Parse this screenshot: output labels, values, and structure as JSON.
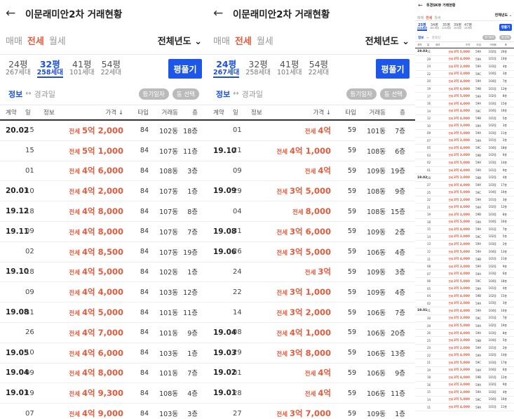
{
  "panels": [
    {
      "title": "이문래미안2차 거래현황",
      "types": [
        "매매",
        "전세",
        "월세"
      ],
      "active_type": 1,
      "year": "전체년도",
      "sizes": [
        {
          "py": "24평",
          "units": "267세대"
        },
        {
          "py": "32평",
          "units": "258세대"
        },
        {
          "py": "41평",
          "units": "101세대"
        },
        {
          "py": "54평",
          "units": "22세대"
        }
      ],
      "active_size": 1,
      "pyeong_button": "평풀기",
      "info_label": "정보",
      "elapsed_label": "경과일",
      "pills": [
        "등기일자",
        "동 선택"
      ],
      "headers": {
        "contract": "계약",
        "day": "일",
        "info": "정보",
        "price": "가격 ↓",
        "type": "타입",
        "dong": "거래동",
        "floor": "층"
      },
      "rows": [
        {
          "c": "20.02",
          "d": "15",
          "i": "",
          "l": "전세",
          "p": "5억 2,000",
          "t": "84",
          "b": "102동",
          "f": "18층"
        },
        {
          "c": "",
          "d": "15",
          "i": "",
          "l": "전세",
          "p": "5억 1,000",
          "t": "84",
          "b": "107동",
          "f": "11층"
        },
        {
          "c": "",
          "d": "01",
          "i": "",
          "l": "전세",
          "p": "4억 6,000",
          "t": "84",
          "b": "108동",
          "f": "3층"
        },
        {
          "c": "20.01",
          "d": "10",
          "i": "",
          "l": "전세",
          "p": "4억 2,000",
          "t": "84",
          "b": "107동",
          "f": "1층"
        },
        {
          "c": "19.12",
          "d": "18",
          "i": "",
          "l": "전세",
          "p": "4억 8,000",
          "t": "84",
          "b": "107동",
          "f": "8층"
        },
        {
          "c": "19.11",
          "d": "09",
          "i": "",
          "l": "전세",
          "p": "4억 8,000",
          "t": "84",
          "b": "107동",
          "f": "7층"
        },
        {
          "c": "",
          "d": "02",
          "i": "",
          "l": "전세",
          "p": "4억 8,500",
          "t": "84",
          "b": "107동",
          "f": "19층"
        },
        {
          "c": "19.10",
          "d": "18",
          "i": "",
          "l": "전세",
          "p": "4억 5,000",
          "t": "84",
          "b": "102동",
          "f": "1층"
        },
        {
          "c": "",
          "d": "09",
          "i": "",
          "l": "전세",
          "p": "4억 4,000",
          "t": "84",
          "b": "103동",
          "f": "12층"
        },
        {
          "c": "19.08",
          "d": "31",
          "i": "",
          "l": "전세",
          "p": "4억 5,000",
          "t": "84",
          "b": "101동",
          "f": "11층"
        },
        {
          "c": "",
          "d": "26",
          "i": "",
          "l": "전세",
          "p": "4억 7,000",
          "t": "84",
          "b": "101동",
          "f": "9층"
        },
        {
          "c": "19.05",
          "d": "10",
          "i": "",
          "l": "전세",
          "p": "4억 6,000",
          "t": "84",
          "b": "103동",
          "f": "1층"
        },
        {
          "c": "19.04",
          "d": "09",
          "i": "",
          "l": "전세",
          "p": "4억 8,000",
          "t": "84",
          "b": "101동",
          "f": "7층"
        },
        {
          "c": "19.01",
          "d": "19",
          "i": "",
          "l": "전세",
          "p": "4억 9,300",
          "t": "84",
          "b": "108동",
          "f": "4층"
        },
        {
          "c": "",
          "d": "07",
          "i": "",
          "l": "전세",
          "p": "4억 9,000",
          "t": "84",
          "b": "103동",
          "f": "3층"
        }
      ]
    },
    {
      "title": "이문래미안2차 거래현황",
      "types": [
        "매매",
        "전세",
        "월세"
      ],
      "active_type": 1,
      "year": "전체년도",
      "sizes": [
        {
          "py": "24평",
          "units": "267세대"
        },
        {
          "py": "32평",
          "units": "258세대"
        },
        {
          "py": "41평",
          "units": "101세대"
        },
        {
          "py": "54평",
          "units": "22세대"
        }
      ],
      "active_size": 0,
      "pyeong_button": "평풀기",
      "info_label": "정보",
      "elapsed_label": "경과일",
      "pills": [
        "등기일자",
        "동 선택"
      ],
      "headers": {
        "contract": "계약",
        "day": "일",
        "info": "정보",
        "price": "가격 ↓",
        "type": "타입",
        "dong": "거래동",
        "floor": "층"
      },
      "rows": [
        {
          "c": "",
          "d": "01",
          "i": "",
          "l": "전세",
          "p": "4억",
          "t": "59",
          "b": "101동",
          "f": "7층"
        },
        {
          "c": "19.10",
          "d": "21",
          "i": "",
          "l": "전세",
          "p": "4억 1,000",
          "t": "59",
          "b": "108동",
          "f": "6층"
        },
        {
          "c": "",
          "d": "09",
          "i": "",
          "l": "전세",
          "p": "4억",
          "t": "59",
          "b": "109동",
          "f": "19층"
        },
        {
          "c": "19.09",
          "d": "29",
          "i": "",
          "l": "전세",
          "p": "3억 5,000",
          "t": "59",
          "b": "108동",
          "f": "9층"
        },
        {
          "c": "",
          "d": "04",
          "i": "",
          "l": "전세",
          "p": "8,000",
          "t": "59",
          "b": "108동",
          "f": "15층"
        },
        {
          "c": "19.08",
          "d": "31",
          "i": "",
          "l": "전세",
          "p": "3억 6,000",
          "t": "59",
          "b": "109동",
          "f": "2층"
        },
        {
          "c": "19.06",
          "d": "26",
          "i": "",
          "l": "전세",
          "p": "3억 5,000",
          "t": "59",
          "b": "106동",
          "f": "4층"
        },
        {
          "c": "",
          "d": "24",
          "i": "",
          "l": "전세",
          "p": "3억",
          "t": "59",
          "b": "109동",
          "f": "3층"
        },
        {
          "c": "",
          "d": "22",
          "i": "",
          "l": "전세",
          "p": "3억 1,000",
          "t": "59",
          "b": "109동",
          "f": "4층"
        },
        {
          "c": "",
          "d": "14",
          "i": "",
          "l": "전세",
          "p": "3억 2,000",
          "t": "59",
          "b": "106동",
          "f": "7층"
        },
        {
          "c": "19.04",
          "d": "08",
          "i": "",
          "l": "전세",
          "p": "4억 1,000",
          "t": "59",
          "b": "106동",
          "f": "20층"
        },
        {
          "c": "19.03",
          "d": "29",
          "i": "",
          "l": "전세",
          "p": "3억 8,000",
          "t": "59",
          "b": "106동",
          "f": "13층"
        },
        {
          "c": "19.02",
          "d": "01",
          "i": "",
          "l": "전세",
          "p": "4억",
          "t": "59",
          "b": "106동",
          "f": "9층"
        },
        {
          "c": "19.01",
          "d": "28",
          "i": "",
          "l": "전세",
          "p": "4억",
          "t": "59",
          "b": "106동",
          "f": "11층"
        },
        {
          "c": "",
          "d": "27",
          "i": "",
          "l": "전세",
          "p": "3억 7,000",
          "t": "59",
          "b": "109동",
          "f": "1층"
        }
      ]
    },
    {
      "title": "휘경SK뷰 거래현황",
      "types": [
        "매매",
        "전세",
        "월세"
      ],
      "active_type": 1,
      "year": "전체년도",
      "sizes": [
        {
          "py": "25평",
          "units": "224세대"
        },
        {
          "py": "34평",
          "units": "482세대"
        },
        {
          "py": "35평",
          "units": "226세대"
        },
        {
          "py": "39평",
          "units": "28세대"
        },
        {
          "py": "47평",
          "units": "28세대"
        }
      ],
      "active_size": 0,
      "pyeong_button": "평풀기",
      "info_label": "정보",
      "elapsed_label": "경과일",
      "pills": [
        "등기일자",
        "동 선택"
      ],
      "headers": {
        "contract": "계약",
        "day": "일",
        "info": "정보",
        "price": "가격",
        "type": "타입",
        "dong": "거래동",
        "floor": "층"
      },
      "rows": [
        {
          "c": "19.03",
          "d": "31",
          "i": "",
          "l": "전세",
          "p": "3억 5,000",
          "t": "59A",
          "b": "102동",
          "f": "20층"
        },
        {
          "c": "",
          "d": "29",
          "i": "",
          "l": "전세",
          "p": "3억 4,000",
          "t": "59A",
          "b": "101동",
          "f": "10층"
        },
        {
          "c": "",
          "d": "24",
          "i": "",
          "l": "전세",
          "p": "3억 2,000",
          "t": "59A",
          "b": "103동",
          "f": "4층"
        },
        {
          "c": "",
          "d": "22",
          "i": "",
          "l": "전세",
          "p": "3억 3,000",
          "t": "59C",
          "b": "104동",
          "f": "3층"
        },
        {
          "c": "",
          "d": "20",
          "i": "",
          "l": "전세",
          "p": "3억 4,000",
          "t": "59A",
          "b": "104동",
          "f": "7층"
        },
        {
          "c": "",
          "d": "19",
          "i": "",
          "l": "전세",
          "p": "3억 6,000",
          "t": "59B",
          "b": "101동",
          "f": "12층"
        },
        {
          "c": "",
          "d": "17",
          "i": "",
          "l": "전세",
          "p": "3억 5,000",
          "t": "59A",
          "b": "102동",
          "f": "8층"
        },
        {
          "c": "",
          "d": "16",
          "i": "",
          "l": "전세",
          "p": "3억 4,000",
          "t": "59A",
          "b": "103동",
          "f": "15층"
        },
        {
          "c": "",
          "d": "14",
          "i": "",
          "l": "전세",
          "p": "3억 4,000",
          "t": "59C",
          "b": "104동",
          "f": "19층"
        },
        {
          "c": "",
          "d": "12",
          "i": "",
          "l": "전세",
          "p": "3억 4,000",
          "t": "59B",
          "b": "101동",
          "f": "5층"
        },
        {
          "c": "",
          "d": "10",
          "i": "",
          "l": "전세",
          "p": "3억 3,000",
          "t": "59A",
          "b": "102동",
          "f": "3층"
        },
        {
          "c": "",
          "d": "09",
          "i": "",
          "l": "전세",
          "p": "3억 5,000",
          "t": "59A",
          "b": "103동",
          "f": "11층"
        },
        {
          "c": "",
          "d": "07",
          "i": "",
          "l": "전세",
          "p": "3억 2,000",
          "t": "59A",
          "b": "101동",
          "f": "2층"
        },
        {
          "c": "",
          "d": "05",
          "i": "",
          "l": "전세",
          "p": "3억 4,000",
          "t": "59C",
          "b": "104동",
          "f": "18층"
        },
        {
          "c": "",
          "d": "03",
          "i": "",
          "l": "전세",
          "p": "3억 3,000",
          "t": "59B",
          "b": "102동",
          "f": "6층"
        },
        {
          "c": "",
          "d": "02",
          "i": "",
          "l": "전세",
          "p": "3억 5,000",
          "t": "59A",
          "b": "103동",
          "f": "14층"
        },
        {
          "c": "",
          "d": "01",
          "i": "",
          "l": "전세",
          "p": "3억 4,000",
          "t": "59A",
          "b": "101동",
          "f": "9층"
        },
        {
          "c": "19.02",
          "d": "28",
          "i": "",
          "l": "전세",
          "p": "3억 3,000",
          "t": "59B",
          "b": "102동",
          "f": "4층"
        },
        {
          "c": "",
          "d": "27",
          "i": "",
          "l": "전세",
          "p": "3억 4,000",
          "t": "59A",
          "b": "103동",
          "f": "17층"
        },
        {
          "c": "",
          "d": "25",
          "i": "",
          "l": "전세",
          "p": "3억 5,000",
          "t": "59C",
          "b": "104동",
          "f": "10층"
        },
        {
          "c": "",
          "d": "22",
          "i": "",
          "l": "전세",
          "p": "3억 2,000",
          "t": "59A",
          "b": "101동",
          "f": "3층"
        },
        {
          "c": "",
          "d": "21",
          "i": "",
          "l": "전세",
          "p": "3억 4,000",
          "t": "59A",
          "b": "102동",
          "f": "12층"
        },
        {
          "c": "",
          "d": "19",
          "i": "",
          "l": "전세",
          "p": "3억 3,000",
          "t": "59B",
          "b": "103동",
          "f": "8층"
        },
        {
          "c": "",
          "d": "18",
          "i": "",
          "l": "전세",
          "p": "3억 5,000",
          "t": "59A",
          "b": "104동",
          "f": "16층"
        },
        {
          "c": "",
          "d": "15",
          "i": "",
          "l": "전세",
          "p": "3억 4,000",
          "t": "59A",
          "b": "101동",
          "f": "7층"
        },
        {
          "c": "",
          "d": "14",
          "i": "",
          "l": "전세",
          "p": "3억 3,000",
          "t": "59C",
          "b": "102동",
          "f": "5층"
        },
        {
          "c": "",
          "d": "13",
          "i": "",
          "l": "전세",
          "p": "3억 2,000",
          "t": "59A",
          "b": "103동",
          "f": "2층"
        },
        {
          "c": "",
          "d": "12",
          "i": "",
          "l": "전세",
          "p": "3억 5,000",
          "t": "59A",
          "b": "104동",
          "f": "13층"
        },
        {
          "c": "",
          "d": "11",
          "i": "",
          "l": "전세",
          "p": "3억 4,000",
          "t": "59B",
          "b": "101동",
          "f": "11층"
        },
        {
          "c": "",
          "d": "08",
          "i": "",
          "l": "전세",
          "p": "3억 3,000",
          "t": "59A",
          "b": "102동",
          "f": "9층"
        },
        {
          "c": "",
          "d": "07",
          "i": "",
          "l": "전세",
          "p": "3억 4,000",
          "t": "59A",
          "b": "103동",
          "f": "6층"
        },
        {
          "c": "",
          "d": "06",
          "i": "",
          "l": "전세",
          "p": "3억 5,000",
          "t": "59C",
          "b": "104동",
          "f": "18층"
        },
        {
          "c": "",
          "d": "05",
          "i": "",
          "l": "전세",
          "p": "3억 3,000",
          "t": "59A",
          "b": "101동",
          "f": "4층"
        },
        {
          "c": "",
          "d": "04",
          "i": "",
          "l": "전세",
          "p": "3억 4,000",
          "t": "59B",
          "b": "102동",
          "f": "15층"
        },
        {
          "c": "",
          "d": "02",
          "i": "",
          "l": "전세",
          "p": "3억 2,000",
          "t": "59A",
          "b": "103동",
          "f": "3층"
        },
        {
          "c": "19.01",
          "d": "31",
          "i": "",
          "l": "전세",
          "p": "3억 4,000",
          "t": "59A",
          "b": "104동",
          "f": "10층"
        },
        {
          "c": "",
          "d": "30",
          "i": "",
          "l": "전세",
          "p": "3억 3,000",
          "t": "59C",
          "b": "101동",
          "f": "7층"
        },
        {
          "c": "",
          "d": "29",
          "i": "",
          "l": "전세",
          "p": "3억 5,000",
          "t": "59A",
          "b": "102동",
          "f": "19층"
        },
        {
          "c": "",
          "d": "26",
          "i": "",
          "l": "전세",
          "p": "3억 4,000",
          "t": "59A",
          "b": "103동",
          "f": "8층"
        },
        {
          "c": "",
          "d": "25",
          "i": "",
          "l": "전세",
          "p": "3억 3,000",
          "t": "59B",
          "b": "104동",
          "f": "5층"
        },
        {
          "c": "",
          "d": "24",
          "i": "",
          "l": "전세",
          "p": "3억 2,000",
          "t": "59A",
          "b": "101동",
          "f": "2층"
        },
        {
          "c": "",
          "d": "22",
          "i": "",
          "l": "전세",
          "p": "3억 4,000",
          "t": "59A",
          "b": "102동",
          "f": "14층"
        },
        {
          "c": "",
          "d": "21",
          "i": "",
          "l": "전세",
          "p": "3억 5,000",
          "t": "59C",
          "b": "103동",
          "f": "17층"
        },
        {
          "c": "",
          "d": "19",
          "i": "",
          "l": "전세",
          "p": "3억 3,000",
          "t": "59A",
          "b": "104동",
          "f": "6층"
        },
        {
          "c": "",
          "d": "18",
          "i": "",
          "l": "전세",
          "p": "3억 4,000",
          "t": "59B",
          "b": "101동",
          "f": "12층"
        },
        {
          "c": "",
          "d": "16",
          "i": "",
          "l": "전세",
          "p": "3억 3,000",
          "t": "59A",
          "b": "102동",
          "f": "9층"
        },
        {
          "c": "",
          "d": "15",
          "i": "",
          "l": "전세",
          "p": "3억 2,000",
          "t": "59A",
          "b": "103동",
          "f": "4층"
        },
        {
          "c": "",
          "d": "14",
          "i": "",
          "l": "전세",
          "p": "3억 5,000",
          "t": "59C",
          "b": "104동",
          "f": "16층"
        },
        {
          "c": "",
          "d": "11",
          "i": "",
          "l": "전세",
          "p": "3억 4,000",
          "t": "59A",
          "b": "101동",
          "f": "11층"
        }
      ]
    }
  ]
}
